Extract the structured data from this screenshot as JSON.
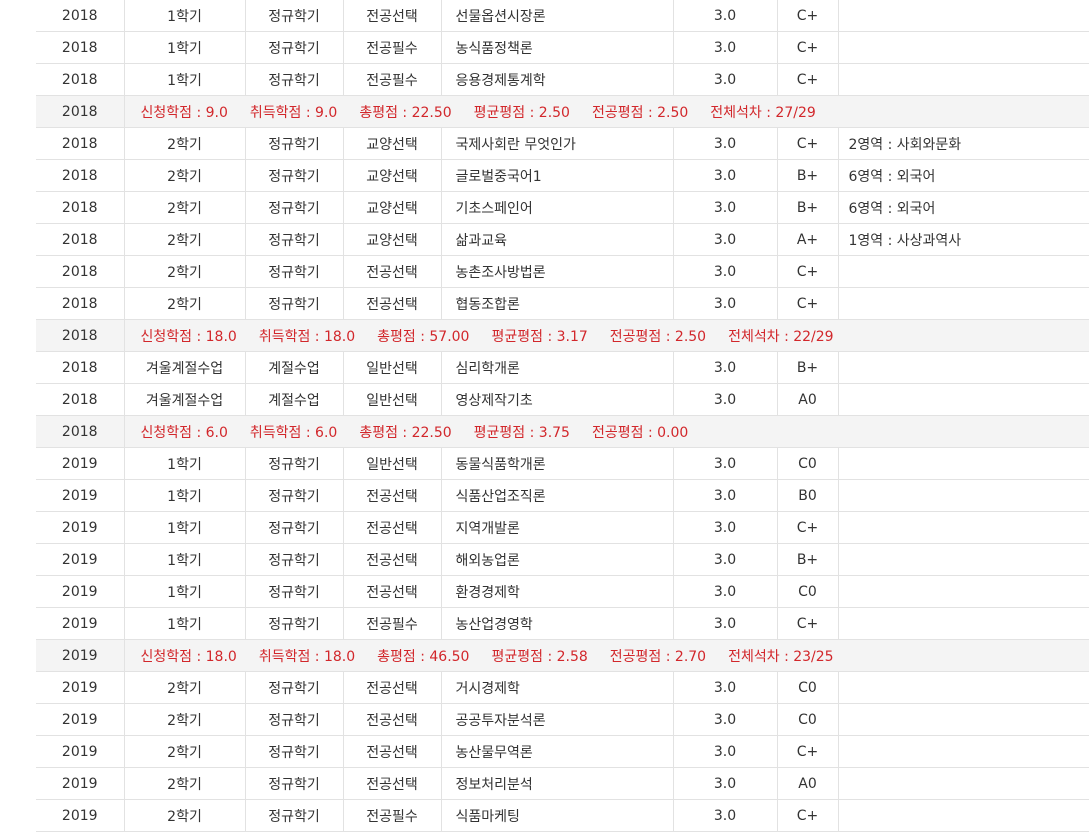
{
  "grade_table": {
    "rows": [
      {
        "type": "course",
        "year": "2018",
        "semester": "1학기",
        "term_type": "정규학기",
        "category": "전공선택",
        "course": "선물옵션시장론",
        "credits": "3.0",
        "grade": "C+",
        "note": ""
      },
      {
        "type": "course",
        "year": "2018",
        "semester": "1학기",
        "term_type": "정규학기",
        "category": "전공필수",
        "course": "농식품정책론",
        "credits": "3.0",
        "grade": "C+",
        "note": ""
      },
      {
        "type": "course",
        "year": "2018",
        "semester": "1학기",
        "term_type": "정규학기",
        "category": "전공필수",
        "course": "응용경제통계학",
        "credits": "3.0",
        "grade": "C+",
        "note": ""
      },
      {
        "type": "summary",
        "year": "2018",
        "items": [
          "신청학점 : 9.0",
          "취득학점 : 9.0",
          "총평점 : 22.50",
          "평균평점 : 2.50",
          "전공평점 : 2.50",
          "전체석차 : 27/29"
        ]
      },
      {
        "type": "course",
        "year": "2018",
        "semester": "2학기",
        "term_type": "정규학기",
        "category": "교양선택",
        "course": "국제사회란 무엇인가",
        "credits": "3.0",
        "grade": "C+",
        "note": "2영역 : 사회와문화"
      },
      {
        "type": "course",
        "year": "2018",
        "semester": "2학기",
        "term_type": "정규학기",
        "category": "교양선택",
        "course": "글로벌중국어1",
        "credits": "3.0",
        "grade": "B+",
        "note": "6영역 : 외국어"
      },
      {
        "type": "course",
        "year": "2018",
        "semester": "2학기",
        "term_type": "정규학기",
        "category": "교양선택",
        "course": "기초스페인어",
        "credits": "3.0",
        "grade": "B+",
        "note": "6영역 : 외국어"
      },
      {
        "type": "course",
        "year": "2018",
        "semester": "2학기",
        "term_type": "정규학기",
        "category": "교양선택",
        "course": "삶과교육",
        "credits": "3.0",
        "grade": "A+",
        "note": "1영역 : 사상과역사"
      },
      {
        "type": "course",
        "year": "2018",
        "semester": "2학기",
        "term_type": "정규학기",
        "category": "전공선택",
        "course": "농촌조사방법론",
        "credits": "3.0",
        "grade": "C+",
        "note": ""
      },
      {
        "type": "course",
        "year": "2018",
        "semester": "2학기",
        "term_type": "정규학기",
        "category": "전공선택",
        "course": "협동조합론",
        "credits": "3.0",
        "grade": "C+",
        "note": ""
      },
      {
        "type": "summary",
        "year": "2018",
        "items": [
          "신청학점 : 18.0",
          "취득학점 : 18.0",
          "총평점 : 57.00",
          "평균평점 : 3.17",
          "전공평점 : 2.50",
          "전체석차 : 22/29"
        ]
      },
      {
        "type": "course",
        "year": "2018",
        "semester": "겨울계절수업",
        "term_type": "계절수업",
        "category": "일반선택",
        "course": "심리학개론",
        "credits": "3.0",
        "grade": "B+",
        "note": ""
      },
      {
        "type": "course",
        "year": "2018",
        "semester": "겨울계절수업",
        "term_type": "계절수업",
        "category": "일반선택",
        "course": "영상제작기초",
        "credits": "3.0",
        "grade": "A0",
        "note": ""
      },
      {
        "type": "summary",
        "year": "2018",
        "items": [
          "신청학점 : 6.0",
          "취득학점 : 6.0",
          "총평점 : 22.50",
          "평균평점 : 3.75",
          "전공평점 : 0.00"
        ]
      },
      {
        "type": "course",
        "year": "2019",
        "semester": "1학기",
        "term_type": "정규학기",
        "category": "일반선택",
        "course": "동물식품학개론",
        "credits": "3.0",
        "grade": "C0",
        "note": ""
      },
      {
        "type": "course",
        "year": "2019",
        "semester": "1학기",
        "term_type": "정규학기",
        "category": "전공선택",
        "course": "식품산업조직론",
        "credits": "3.0",
        "grade": "B0",
        "note": ""
      },
      {
        "type": "course",
        "year": "2019",
        "semester": "1학기",
        "term_type": "정규학기",
        "category": "전공선택",
        "course": "지역개발론",
        "credits": "3.0",
        "grade": "C+",
        "note": ""
      },
      {
        "type": "course",
        "year": "2019",
        "semester": "1학기",
        "term_type": "정규학기",
        "category": "전공선택",
        "course": "해외농업론",
        "credits": "3.0",
        "grade": "B+",
        "note": ""
      },
      {
        "type": "course",
        "year": "2019",
        "semester": "1학기",
        "term_type": "정규학기",
        "category": "전공선택",
        "course": "환경경제학",
        "credits": "3.0",
        "grade": "C0",
        "note": ""
      },
      {
        "type": "course",
        "year": "2019",
        "semester": "1학기",
        "term_type": "정규학기",
        "category": "전공필수",
        "course": "농산업경영학",
        "credits": "3.0",
        "grade": "C+",
        "note": ""
      },
      {
        "type": "summary",
        "year": "2019",
        "items": [
          "신청학점 : 18.0",
          "취득학점 : 18.0",
          "총평점 : 46.50",
          "평균평점 : 2.58",
          "전공평점 : 2.70",
          "전체석차 : 23/25"
        ]
      },
      {
        "type": "course",
        "year": "2019",
        "semester": "2학기",
        "term_type": "정규학기",
        "category": "전공선택",
        "course": "거시경제학",
        "credits": "3.0",
        "grade": "C0",
        "note": ""
      },
      {
        "type": "course",
        "year": "2019",
        "semester": "2학기",
        "term_type": "정규학기",
        "category": "전공선택",
        "course": "공공투자분석론",
        "credits": "3.0",
        "grade": "C0",
        "note": ""
      },
      {
        "type": "course",
        "year": "2019",
        "semester": "2학기",
        "term_type": "정규학기",
        "category": "전공선택",
        "course": "농산물무역론",
        "credits": "3.0",
        "grade": "C+",
        "note": ""
      },
      {
        "type": "course",
        "year": "2019",
        "semester": "2학기",
        "term_type": "정규학기",
        "category": "전공선택",
        "course": "정보처리분석",
        "credits": "3.0",
        "grade": "A0",
        "note": ""
      },
      {
        "type": "course",
        "year": "2019",
        "semester": "2학기",
        "term_type": "정규학기",
        "category": "전공필수",
        "course": "식품마케팅",
        "credits": "3.0",
        "grade": "C+",
        "note": ""
      }
    ]
  },
  "colors": {
    "summary_text": "#d2272b",
    "summary_background": "#f4f4f4",
    "body_text": "#333333",
    "border": "#e2e2e2"
  }
}
